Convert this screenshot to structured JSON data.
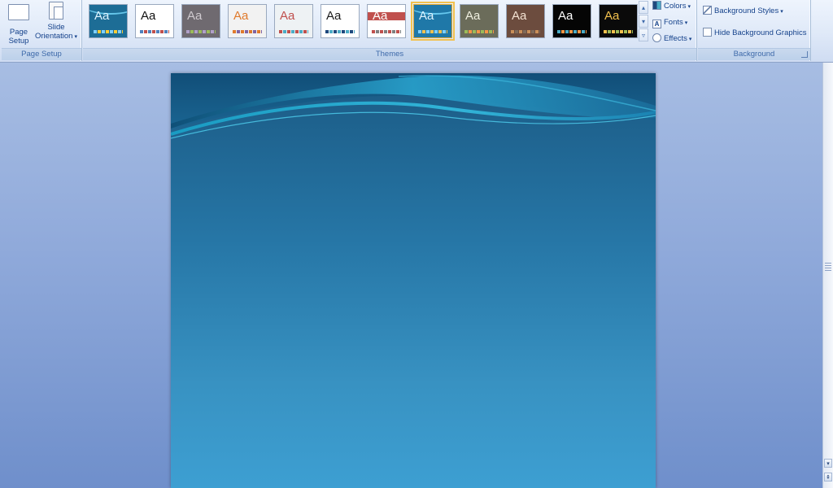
{
  "ribbon": {
    "page_setup": {
      "label": "Page Setup",
      "page_setup_button": [
        "Page",
        "Setup"
      ],
      "orientation_button": [
        "Slide",
        "Orientation"
      ],
      "orientation_caret": "▾"
    },
    "themes": {
      "label": "Themes",
      "thumbnail_text": "Aa",
      "thumbnails": [
        {
          "name": "theme-1",
          "bg": "#1d6d96",
          "fg": "#dff4ff",
          "c1": "#7fd0ff",
          "c2": "#ffcc33",
          "selected": false
        },
        {
          "name": "theme-2",
          "bg": "#ffffff",
          "fg": "#111111",
          "c1": "#4f81bd",
          "c2": "#c0504d",
          "selected": false
        },
        {
          "name": "theme-3",
          "bg": "#6f6a70",
          "fg": "#cfcacf",
          "c1": "#b0a0c8",
          "c2": "#9bbb59",
          "selected": false
        },
        {
          "name": "theme-4",
          "bg": "#f2f2f2",
          "fg": "#e07a2c",
          "c1": "#e07a2c",
          "c2": "#8064a2",
          "selected": false
        },
        {
          "name": "theme-5",
          "bg": "#eef2f4",
          "fg": "#c0504d",
          "c1": "#c0504d",
          "c2": "#4bacc6",
          "selected": false
        },
        {
          "name": "theme-6",
          "bg": "#ffffff",
          "fg": "#1a1a1a",
          "c1": "#1f497d",
          "c2": "#4bacc6",
          "selected": false
        },
        {
          "name": "theme-7",
          "bg": "#ffffff",
          "fg": "#ffffff",
          "c1": "#c0504d",
          "c2": "#7f7f7f",
          "selected": false
        },
        {
          "name": "theme-8",
          "bg": "#1f78a8",
          "fg": "#dff4ff",
          "c1": "#7fd0ff",
          "c2": "#f2c14e",
          "selected": true
        },
        {
          "name": "theme-9",
          "bg": "#6b6c5a",
          "fg": "#efefe0",
          "c1": "#9bbb59",
          "c2": "#f79646",
          "selected": false
        },
        {
          "name": "theme-10",
          "bg": "#6c4c3e",
          "fg": "#f4e3d3",
          "c1": "#c98f5a",
          "c2": "#7f6a5a",
          "selected": false
        },
        {
          "name": "theme-11",
          "bg": "#050505",
          "fg": "#ffffff",
          "c1": "#4bacc6",
          "c2": "#f79646",
          "selected": false
        },
        {
          "name": "theme-12",
          "bg": "#0a0a0a",
          "fg": "#f2c14e",
          "c1": "#f2c14e",
          "c2": "#9bbb59",
          "selected": false
        }
      ],
      "colors": "Colors",
      "fonts": "Fonts",
      "fonts_icon_letter": "A",
      "effects": "Effects",
      "caret": "▾"
    },
    "background": {
      "label": "Background",
      "background_styles": "Background Styles",
      "hide_background_graphics": "Hide Background Graphics",
      "caret": "▾"
    }
  },
  "scroll": {
    "up": "▴",
    "down": "▾",
    "more": "▿"
  },
  "vscroll": {
    "bottom": "⇞"
  }
}
